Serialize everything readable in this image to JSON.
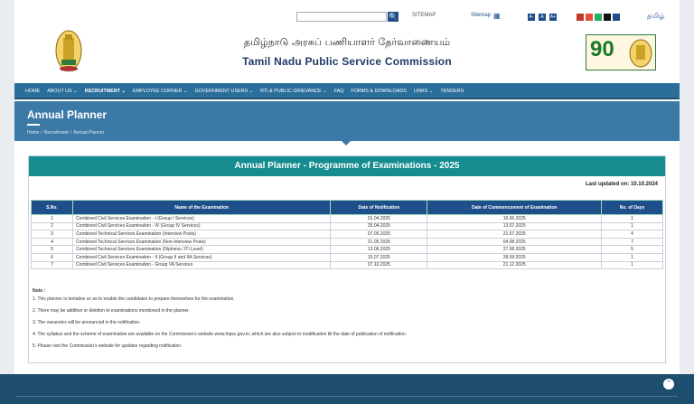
{
  "util": {
    "search_placeholder": "",
    "search_btn": "🔍",
    "sitemap_icon_text": "SITEMAP",
    "sitemap_label": "Sitemap",
    "font_sizes": [
      "A-",
      "A",
      "A+"
    ],
    "theme_colors": [
      "#c0392b",
      "#e74c3c",
      "#27ae60",
      "#111111",
      "#1f4e8c"
    ],
    "language": "தமிழ்"
  },
  "header": {
    "title_tamil": "தமிழ்நாடு அரசுப் பணியாளர் தேர்வாணையம்",
    "title_english": "Tamil Nadu Public Service Commission",
    "badge_text": "90"
  },
  "nav": {
    "items": [
      {
        "label": "HOME",
        "active": false
      },
      {
        "label": "ABOUT US ⌄",
        "active": false
      },
      {
        "label": "RECRUITMENT ⌄",
        "active": true
      },
      {
        "label": "EMPLOYEE CORNER ⌄",
        "active": false
      },
      {
        "label": "GOVERNMENT USERS ⌄",
        "active": false
      },
      {
        "label": "RTI & PUBLIC GRIEVANCE ⌄",
        "active": false
      },
      {
        "label": "FAQ",
        "active": false
      },
      {
        "label": "FORMS & DOWNLOADS",
        "active": false
      },
      {
        "label": "LINKS ⌄",
        "active": false
      },
      {
        "label": "TENDERS",
        "active": false
      }
    ]
  },
  "banner": {
    "title": "Annual Planner",
    "breadcrumb": [
      "Home",
      "Recruitment",
      "Annual Planner"
    ]
  },
  "planner": {
    "heading": "Annual Planner - Programme of Examinations - 2025",
    "updated": "Last updated on: 10.10.2024",
    "columns": [
      "S.No.",
      "Name of the Examination",
      "Date of Notification",
      "Date of Commencement of Examination",
      "No. of Days"
    ],
    "rows": [
      [
        "1",
        "Combined Civil Services Examination - I (Group I Services)",
        "01.04.2025",
        "15.06.2025",
        "1"
      ],
      [
        "2",
        "Combined Civil Services Examination - IV (Group IV Services)",
        "25.04.2025",
        "13.07.2025",
        "1"
      ],
      [
        "3",
        "Combined Technical Services Examination (Interview Posts)",
        "07.05.2025",
        "21.07.2025",
        "4"
      ],
      [
        "4",
        "Combined Technical Services Examination (Non-Interview Posts)",
        "21.05.2025",
        "04.08.2025",
        "7"
      ],
      [
        "5",
        "Combined Technical Services Examination (Diploma / ITI Level)",
        "13.06.2025",
        "27.08.2025",
        "5"
      ],
      [
        "6",
        "Combined Civil Services Examination - II (Group II and IIA Services)",
        "15.07.2025",
        "28.09.2025",
        "1"
      ],
      [
        "7",
        "Combined Civil Services Examination - Group VA Services",
        "07.10.2025",
        "21.12.2025",
        "1"
      ]
    ],
    "note_heading": "Note :",
    "notes": [
      "1. This planner is tentative so as to enable the candidates to prepare themselves for the examination.",
      "2. There may be addition or deletion to examinations mentioned in the planner.",
      "3. The vacancies will be announced in the notification.",
      "4. The syllabus and the scheme of examination are available on the Commission's website www.tnpsc.gov.in, which are also subject to modification till the date of publication of notification.",
      "5. Please visit the Commission's website for updates regarding notification."
    ]
  },
  "footer": {
    "to_top": "⌃"
  }
}
